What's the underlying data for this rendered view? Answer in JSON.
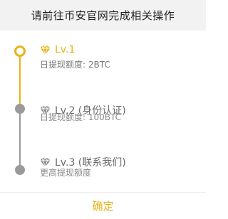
{
  "dialog": {
    "title": "请前往币安官网完成相关操作"
  },
  "levels": [
    {
      "icon": "diamond-icon",
      "title": "Lv.1",
      "description": "日提现额度: 2BTC",
      "status": "active",
      "color": "#e9b31a"
    },
    {
      "icon": "diamond-icon",
      "title": "Lv.2 (身份认证)",
      "description": "日提现额度: 100BTC",
      "status": "inactive",
      "color": "#8c8c8c"
    },
    {
      "icon": "diamond-icon",
      "title": "Lv.3 (联系我们)",
      "description": "更高提现额度",
      "status": "inactive",
      "color": "#8c8c8c"
    }
  ],
  "footer": {
    "confirm_label": "确定"
  },
  "colors": {
    "accent": "#e9b31a",
    "inactive": "#9a9a9a",
    "header_bg": "#f2f2f2"
  }
}
